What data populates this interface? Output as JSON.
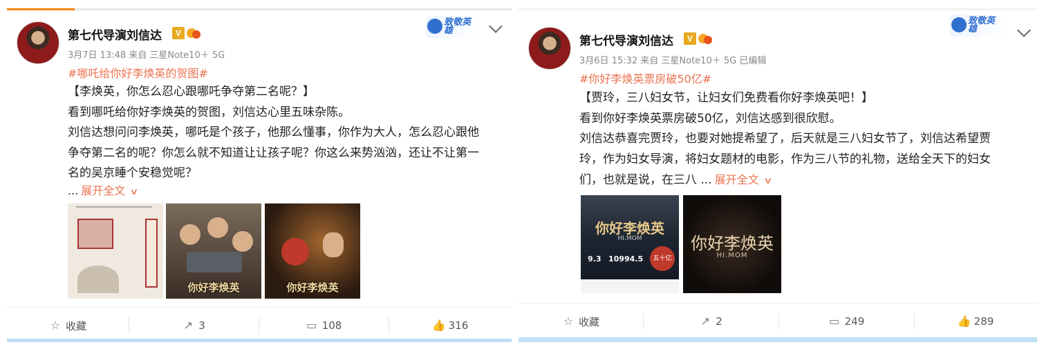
{
  "posts": [
    {
      "author": "第七代导演刘信达",
      "meta": "3月7日 13:48 来自 三星Note10＋ 5G",
      "topic": "#哪吒给你好李焕英的贺图#",
      "lines": [
        "【李焕英，你怎么忍心跟哪吒争夺第二名呢？】",
        "看到哪吒给你好李焕英的贺图，刘信达心里五味杂陈。",
        "刘信达想问问李焕英，哪吒是个孩子，他那么懂事，你作为大人，怎么忍心跟他",
        "争夺第二名的呢？你怎么就不知道让让孩子呢？你这么来势汹汹，还让不让第一",
        "名的吴京睡个安稳觉呢？"
      ],
      "more_prefix": "...",
      "more_link": "展开全文",
      "badge_text": "致敬英雄",
      "images": [
        {
          "caption": "",
          "sub": ""
        },
        {
          "caption": "你好李焕英",
          "sub": ""
        },
        {
          "caption": "你好李焕英",
          "sub": ""
        }
      ],
      "actions": {
        "fav": "收藏",
        "repost": "3",
        "comment": "108",
        "like": "316"
      }
    },
    {
      "author": "第七代导演刘信达",
      "meta": "3月6日 15:32 来自 三星Note10＋ 5G  已编辑",
      "topic": "#你好李焕英票房破50亿#",
      "lines": [
        "【贾玲，三八妇女节，让妇女们免费看你好李焕英吧！】",
        "看到你好李焕英票房破50亿，刘信达感到很欣慰。",
        "刘信达恭喜完贾玲，也要对她提希望了，后天就是三八妇女节了，刘信达希望贾",
        "玲，作为妇女导演，将妇女题材的电影，作为三八节的礼物，送给全天下的妇女"
      ],
      "last_line": "们，也就是说，在三八 ...",
      "more_link": "展开全文",
      "badge_text": "致敬英雄",
      "images": [
        {
          "caption": "你好李焕英",
          "sub": "HI.MOM",
          "stat1": "9.3",
          "stat2": "10994.5",
          "tag": "五十亿"
        },
        {
          "caption": "你好李焕英",
          "sub": "HI.MOM"
        }
      ],
      "actions": {
        "fav": "收藏",
        "repost": "2",
        "comment": "249",
        "like": "289"
      }
    }
  ],
  "colors": {
    "accent": "#eb7350",
    "topic": "#eb7350",
    "badge": "#e8a81f",
    "bottom_bar": "#bfdef3"
  },
  "icons": [
    "star-icon",
    "repost-icon",
    "comment-icon",
    "like-icon",
    "chevron-down-icon",
    "verified-v-icon",
    "fans-icon"
  ]
}
